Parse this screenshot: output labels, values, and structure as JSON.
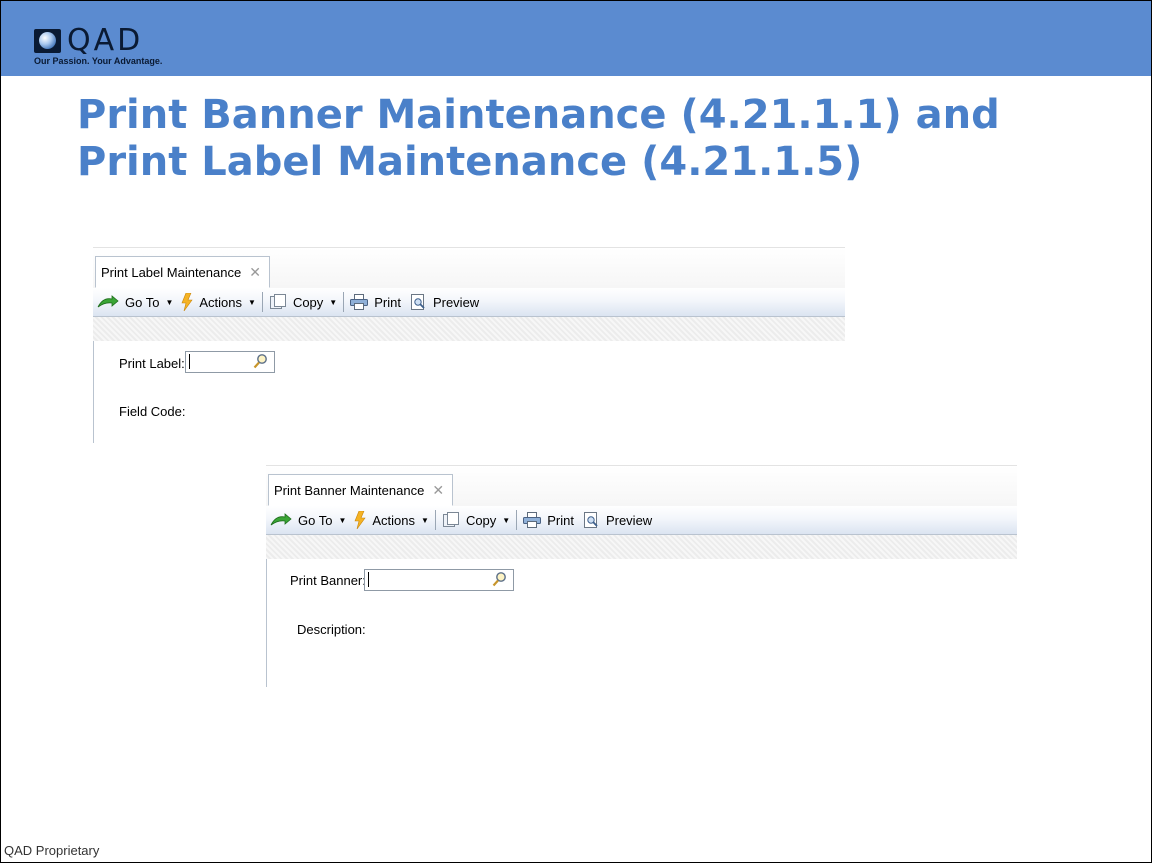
{
  "header": {
    "logo_text": "QAD",
    "tagline": "Our Passion. Your Advantage.",
    "accent_color": "#5b8bd0"
  },
  "slide": {
    "title_line1": "Print Banner Maintenance (4.21.1.1) and",
    "title_line2": "Print Label Maintenance (4.21.1.5)",
    "title_color": "#4a80c9",
    "footer": "QAD Proprietary"
  },
  "windows": [
    {
      "tab_title": "Print Label Maintenance",
      "close_glyph": "✕",
      "toolbar": {
        "goto": "Go To",
        "actions": "Actions",
        "copy": "Copy",
        "print": "Print",
        "preview": "Preview"
      },
      "field1_label": "Print Label:",
      "field1_value": "",
      "field2_label": "Field Code:"
    },
    {
      "tab_title": "Print Banner Maintenance",
      "close_glyph": "✕",
      "toolbar": {
        "goto": "Go To",
        "actions": "Actions",
        "copy": "Copy",
        "print": "Print",
        "preview": "Preview"
      },
      "field1_label": "Print Banner:",
      "field1_value": "",
      "field2_label": "Description:"
    }
  ],
  "icons": {
    "goto": "green-arrow-icon",
    "actions": "lightning-icon",
    "copy": "copy-pages-icon",
    "print": "printer-icon",
    "preview": "preview-page-icon",
    "search": "magnifier-icon",
    "dropdown": "dropdown-arrow-icon"
  }
}
